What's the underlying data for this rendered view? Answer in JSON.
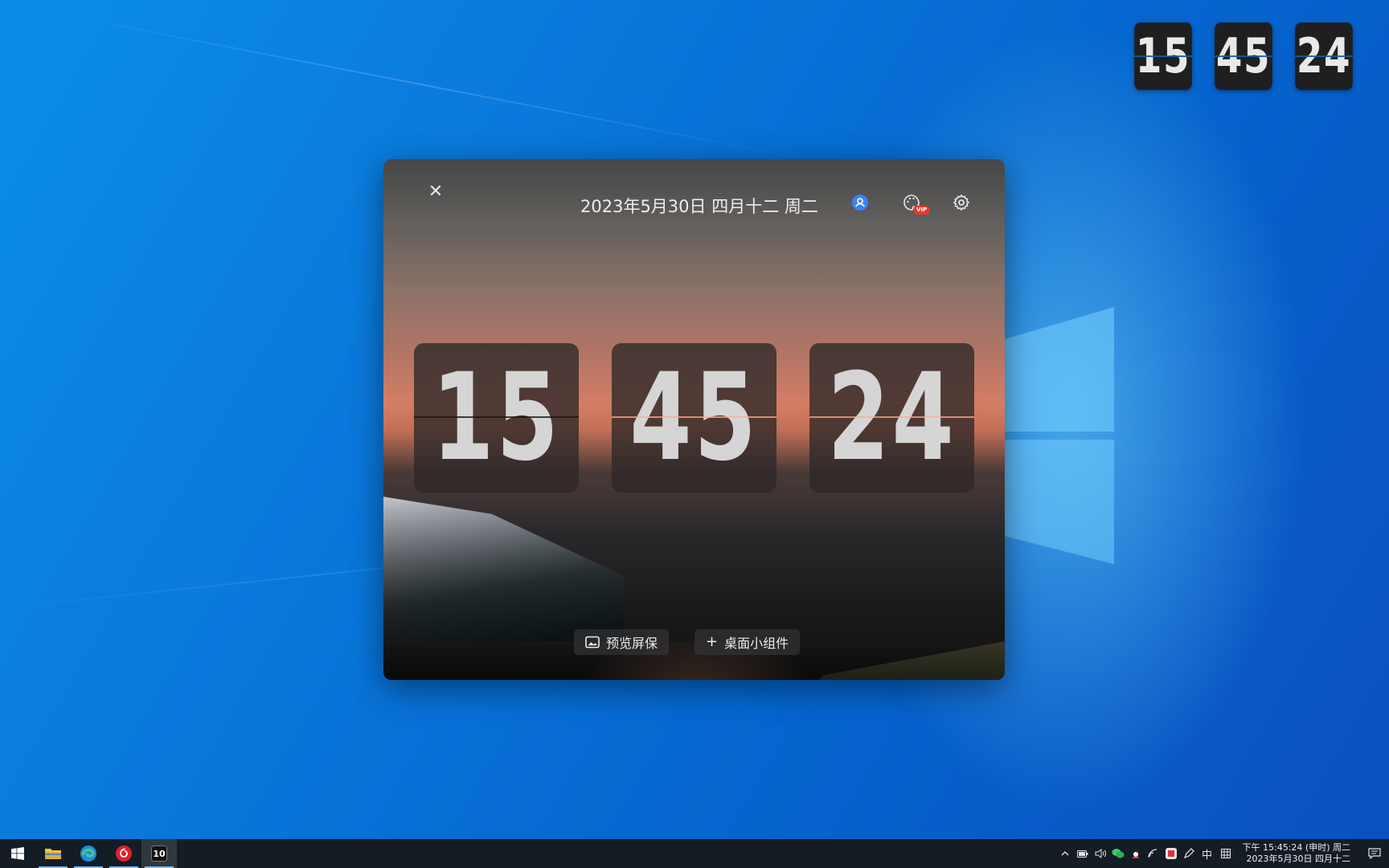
{
  "desktop_widget": {
    "hours": "15",
    "minutes": "45",
    "seconds": "24"
  },
  "app": {
    "date": "2023年5月30日 四月十二 周二",
    "close_glyph": "✕",
    "vip_label": "VIP",
    "time": {
      "hours": "15",
      "minutes": "45",
      "seconds": "24"
    },
    "buttons": {
      "preview": "预览屏保",
      "widget": "桌面小组件",
      "widget_glyph": "+"
    },
    "colors": {
      "accent_user_icon": "#3b82f6",
      "vip_badge": "#e03c31"
    }
  },
  "taskbar": {
    "apps": [
      {
        "name": "start"
      },
      {
        "name": "file-explorer"
      },
      {
        "name": "edge"
      },
      {
        "name": "netease-music"
      },
      {
        "name": "flip-clock",
        "label": "10",
        "active": true
      }
    ],
    "tray": {
      "ime": "中",
      "chevron": "^",
      "time_line1": "下午 15:45:24 (申时) 周二",
      "time_line2": "2023年5月30日 四月十二"
    }
  }
}
